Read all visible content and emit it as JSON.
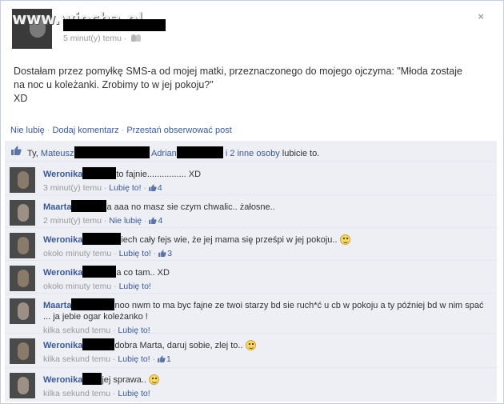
{
  "watermark": "www.wiocha.pl",
  "post": {
    "time": "5 minut(y) temu",
    "text": "Dostałam przez pomyłkę SMS-a od mojej matki, przeznaczonego do mojego ojczyma: \"Młoda zostaje\nna noc u koleżanki. Zrobimy to w jej pokoju?\"\nXD",
    "close_symbol": "×"
  },
  "actions": {
    "like": "Nie lubię",
    "comment": "Dodaj komentarz",
    "unfollow": "Przestań obserwować post",
    "separator": "·"
  },
  "likes": {
    "prefix": "Ty,",
    "name1": "Mateusz",
    "name2": "Adrian",
    "others": "i 2 inne osoby",
    "suffix": "lubicie to."
  },
  "comments": [
    {
      "author": "Weronika",
      "text": "to fajnie................ XD",
      "time": "3 minut(y) temu",
      "like": "Lubię to!",
      "likes": "4"
    },
    {
      "author": "Maarta",
      "text": "a aaa no masz sie czym chwalic.. żałosne..",
      "time": "2 minut(y) temu",
      "like": "Nie lubię",
      "likes": "4"
    },
    {
      "author": "Weronika",
      "text": "iech cały fejs wie, że jej mama się prześpi w jej pokoju..",
      "time": "około minuty temu",
      "like": "Lubię to!",
      "likes": "3"
    },
    {
      "author": "Weronika",
      "text": "a co tam.. XD",
      "time": "około minuty temu",
      "like": "Lubię to!",
      "likes": ""
    },
    {
      "author": "Maarta",
      "text": "noo nwm to ma byc fajne ze twoi starzy bd sie ruch*ć u cb w pokoju a ty później bd w nim spać ... ja jebie ogar koleżanko !",
      "time": "kilka sekund temu",
      "like": "Lubię to!",
      "likes": ""
    },
    {
      "author": "Weronika",
      "text": "dobra Marta, daruj sobie, zlej to..",
      "time": "kilka sekund temu",
      "like": "Lubię to!",
      "likes": "1"
    },
    {
      "author": "Weronika",
      "text": "jej sprawa..",
      "time": "kilka sekund temu",
      "like": "Lubię to!",
      "likes": ""
    }
  ],
  "meta_separator": "·",
  "colors": {
    "link": "#3b5998",
    "feedback_bg": "#edeff4",
    "muted": "#999999"
  }
}
